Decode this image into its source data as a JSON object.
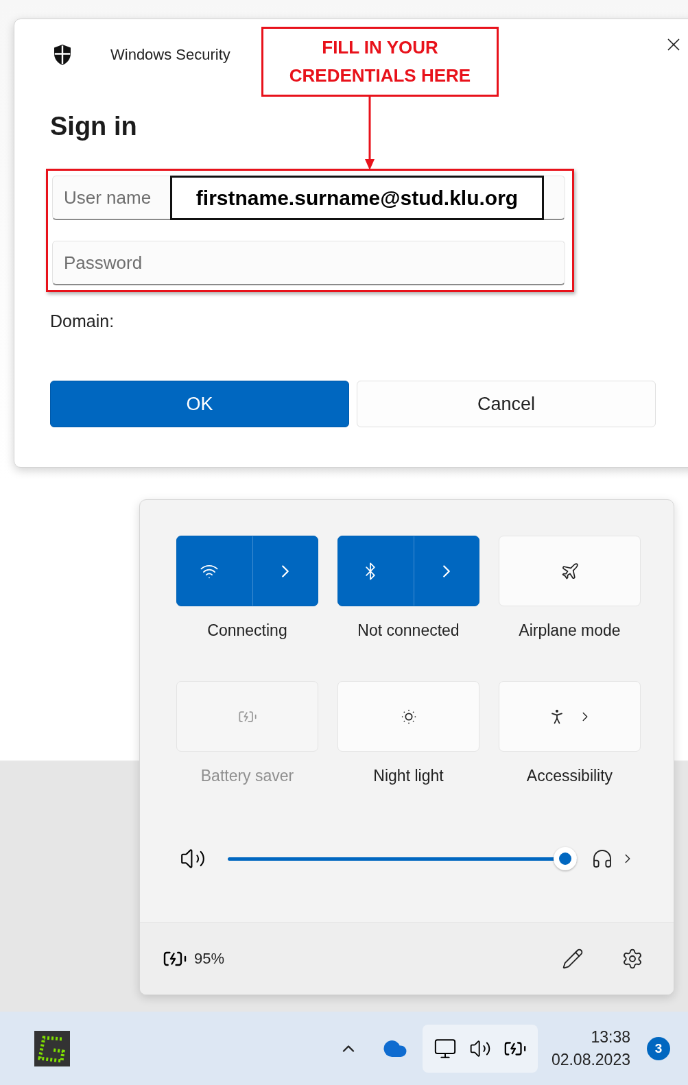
{
  "dialog": {
    "app_name": "Windows Security",
    "title": "Sign in",
    "fields": [
      {
        "placeholder": "User name"
      },
      {
        "placeholder": "Password"
      }
    ],
    "domain_label": "Domain:",
    "buttons": [
      {
        "label": "OK",
        "kind": "primary"
      },
      {
        "label": "Cancel",
        "kind": "secondary"
      }
    ]
  },
  "annotation": {
    "callout": "FILL IN YOUR CREDENTIALS HERE",
    "example_value": "firstname.surname@stud.klu.org"
  },
  "quick_settings": {
    "tiles": [
      {
        "label": "Connecting",
        "kind": "wifi",
        "on": true,
        "expandable": true,
        "disabled": false
      },
      {
        "label": "Not connected",
        "kind": "bluetooth",
        "on": true,
        "expandable": true,
        "disabled": false
      },
      {
        "label": "Airplane mode",
        "kind": "airplane",
        "on": false,
        "expandable": false,
        "disabled": false
      },
      {
        "label": "Battery saver",
        "kind": "battery-saver",
        "on": false,
        "expandable": false,
        "disabled": true
      },
      {
        "label": "Night light",
        "kind": "night-light",
        "on": false,
        "expandable": false,
        "disabled": false
      },
      {
        "label": "Accessibility",
        "kind": "accessibility",
        "on": false,
        "expandable": true,
        "disabled": false
      }
    ],
    "volume": {
      "level": 0.98
    },
    "battery": "95%"
  },
  "taskbar": {
    "time": "13:38",
    "date": "02.08.2023",
    "notification_count": "3"
  }
}
